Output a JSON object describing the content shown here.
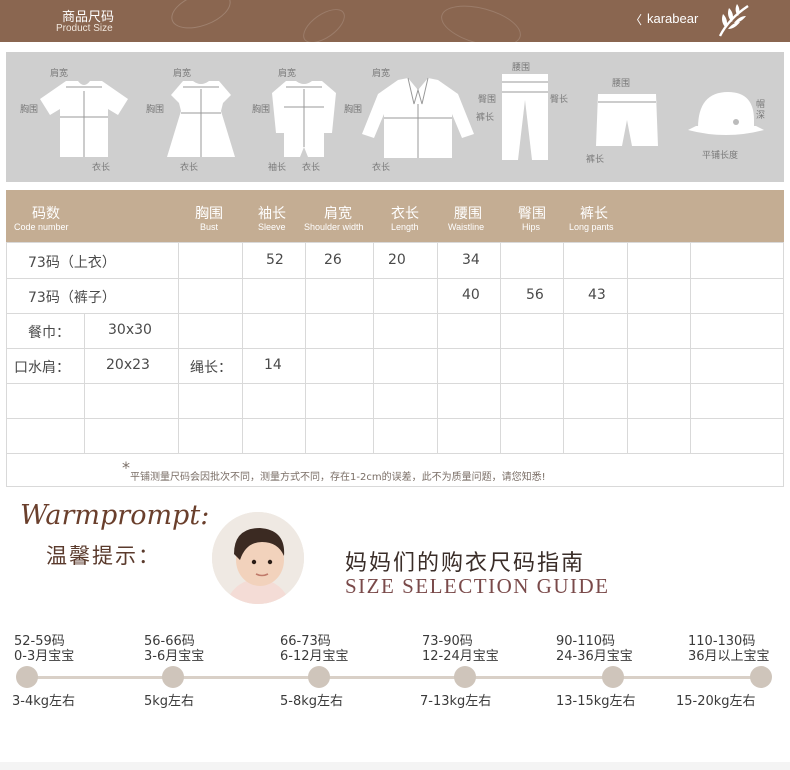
{
  "header": {
    "title": "商品尺码",
    "subtitle": "Product Size",
    "chevron": "〈",
    "brand": "karabear"
  },
  "garments": {
    "tshirt": {
      "shoulder": "肩宽",
      "chest": "胸围",
      "length": "衣长"
    },
    "dress": {
      "shoulder": "肩宽",
      "chest": "胸围",
      "length": "衣长"
    },
    "romper": {
      "shoulder": "肩宽",
      "chest": "胸围",
      "sleeve": "袖长",
      "length": "衣长"
    },
    "jacket": {
      "shoulder": "肩宽",
      "chest": "胸围",
      "length": "衣长"
    },
    "pants": {
      "waist": "腰围",
      "hips": "臀围",
      "hips2": "臀长",
      "pant_length": "裤长"
    },
    "shorts": {
      "waist": "腰围",
      "pant_length": "裤长"
    },
    "hat": {
      "depth": "帽深",
      "flat_length": "平铺长度"
    }
  },
  "table": {
    "headers": [
      {
        "zh": "码数",
        "en": "Code number"
      },
      {
        "zh": "胸围",
        "en": "Bust"
      },
      {
        "zh": "袖长",
        "en": "Sleeve"
      },
      {
        "zh": "肩宽",
        "en": "Shoulder width"
      },
      {
        "zh": "衣长",
        "en": "Length"
      },
      {
        "zh": "腰围",
        "en": "Waistline"
      },
      {
        "zh": "臀围",
        "en": "Hips"
      },
      {
        "zh": "裤长",
        "en": "Long pants"
      }
    ],
    "rows": [
      {
        "label": "73码（上衣）",
        "sleeve": "52",
        "shoulder": "26",
        "length": "20",
        "waist": "34"
      },
      {
        "label": "73码（裤子）",
        "waist": "40",
        "hips": "56",
        "pants": "43"
      },
      {
        "label": "餐巾：",
        "size": "30x30"
      },
      {
        "label": "口水肩：",
        "size": "20x23",
        "cord_label": "绳长：",
        "cord": "14"
      }
    ],
    "note_star": "*",
    "note": "平铺测量尺码会因批次不同，测量方式不同，存在1-2cm的误差，此不为质量问题，请您知悉!"
  },
  "warm": {
    "script": "Warmprompt:",
    "zh": "温馨提示："
  },
  "guide": {
    "zh": "妈妈们的购衣尺码指南",
    "en": "SIZE SELECTION GUIDE"
  },
  "timeline": [
    {
      "size": "52-59码",
      "age": "0-3月宝宝",
      "weight": "3-4kg左右"
    },
    {
      "size": "56-66码",
      "age": "3-6月宝宝",
      "weight": "5kg左右"
    },
    {
      "size": "66-73码",
      "age": "6-12月宝宝",
      "weight": "5-8kg左右"
    },
    {
      "size": "73-90码",
      "age": "12-24月宝宝",
      "weight": "7-13kg左右"
    },
    {
      "size": "90-110码",
      "age": "24-36月宝宝",
      "weight": "13-15kg左右"
    },
    {
      "size": "110-130码",
      "age": "36月以上宝宝",
      "weight": "15-20kg左右"
    }
  ],
  "colors": {
    "header_bg": "#8a6650",
    "table_header_bg": "#c4ad93",
    "icon_band_bg": "#cfcfcf",
    "accent_text": "#6a3f2c"
  }
}
